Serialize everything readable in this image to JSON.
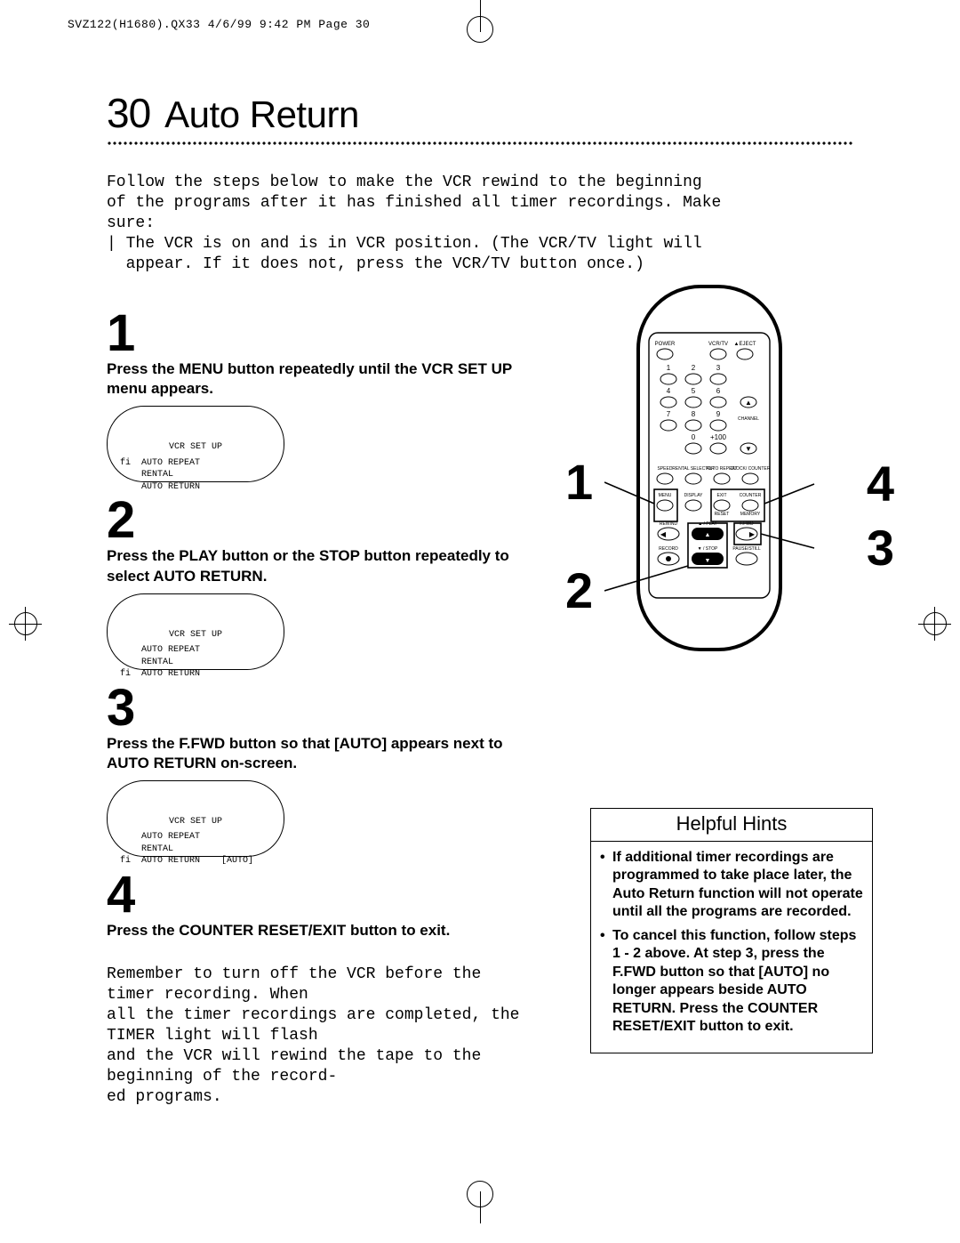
{
  "header_line": "SVZ122(H1680).QX33  4/6/99 9:42 PM  Page 30",
  "page_number": "30",
  "title": "Auto Return",
  "intro_lines": [
    "Follow the steps below to make the VCR rewind to the beginning",
    "of the programs after it has finished all timer recordings. Make",
    "sure:",
    "| The VCR is on and is in VCR position. (The VCR/TV light will",
    "  appear. If it does not, press the VCR/TV button once.)"
  ],
  "steps": {
    "s1": {
      "num": "1",
      "head": "Press the MENU button repeatedly until the VCR SET UP menu appears."
    },
    "s2": {
      "num": "2",
      "head": "Press the PLAY button or the STOP button repeatedly to select AUTO RETURN."
    },
    "s3": {
      "num": "3",
      "head": "Press the F.FWD button so that [AUTO] appears next to AUTO RETURN on-screen."
    },
    "s4": {
      "num": "4",
      "head": "Press the COUNTER RESET/EXIT button to exit."
    }
  },
  "osd_title": "VCR SET UP",
  "osd1": "fi  AUTO REPEAT\n    RENTAL\n    AUTO RETURN",
  "osd2": "    AUTO REPEAT\n    RENTAL\nfi  AUTO RETURN",
  "osd3": "    AUTO REPEAT\n    RENTAL\nfi  AUTO RETURN    [AUTO]",
  "after4_lines": [
    "Remember to turn off the VCR before the timer recording. When",
    "all the timer recordings are completed, the TIMER light will flash",
    "and the VCR will rewind the tape to the beginning of the record-",
    "ed programs."
  ],
  "callouts": {
    "c1": "1",
    "c2": "2",
    "c3": "3",
    "c4": "4"
  },
  "hints_title": "Helpful Hints",
  "hint1": "If additional timer recordings are programmed to take place later, the Auto Return function will not operate until all the programs are recorded.",
  "hint2": "To cancel this function, follow steps 1 - 2 above. At step 3, press the F.FWD button so that [AUTO] no longer appears beside AUTO RETURN. Press the COUNTER RESET/EXIT button to exit.",
  "remote_labels": {
    "power": "POWER",
    "vcrtv": "VCR/TV",
    "eject": "▲EJECT",
    "n1": "1",
    "n2": "2",
    "n3": "3",
    "n4": "4",
    "n5": "5",
    "n6": "6",
    "n7": "7",
    "n8": "8",
    "n9": "9",
    "n0": "0",
    "p100": "+100",
    "channel": "CHANNEL",
    "up": "▲",
    "down": "▼",
    "speed": "SPEED",
    "rental": "RENTAL SELECTOR",
    "auto": "AUTO REPEAT",
    "clock": "CLOCK/ COUNTER",
    "menu": "MENU",
    "display": "DISPLAY",
    "exit": "EXIT",
    "counter": "COUNTER",
    "reset": "RESET",
    "memory": "MEMORY",
    "rewind": "REWIND",
    "play": "▲ / PLAY",
    "ffwd": "F.FWD",
    "record": "RECORD",
    "stop": "▼ / STOP",
    "pause": "PAUSE/STILL"
  }
}
